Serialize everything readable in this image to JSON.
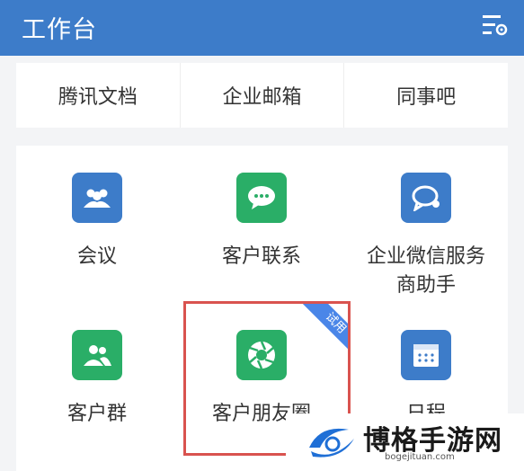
{
  "header": {
    "title": "工作台"
  },
  "quick_links": [
    "腾讯文档",
    "企业邮箱",
    "同事吧"
  ],
  "apps": [
    {
      "label": "会议",
      "icon": "meeting-icon",
      "color": "#3d7cc9"
    },
    {
      "label": "客户联系",
      "icon": "chat-bubble-icon",
      "color": "#2aae67"
    },
    {
      "label": "企业微信服务商助手",
      "icon": "service-chat-icon",
      "color": "#3d7cc9"
    },
    {
      "label": "客户群",
      "icon": "group-icon",
      "color": "#2aae67"
    },
    {
      "label": "客户朋友圈",
      "icon": "moments-aperture-icon",
      "color": "#2aae67",
      "badge": "试用"
    },
    {
      "label": "日程",
      "icon": "calendar-icon",
      "color": "#3d7cc9"
    }
  ],
  "watermark": {
    "text": "博格手游网",
    "url": "bogejituan.com"
  }
}
